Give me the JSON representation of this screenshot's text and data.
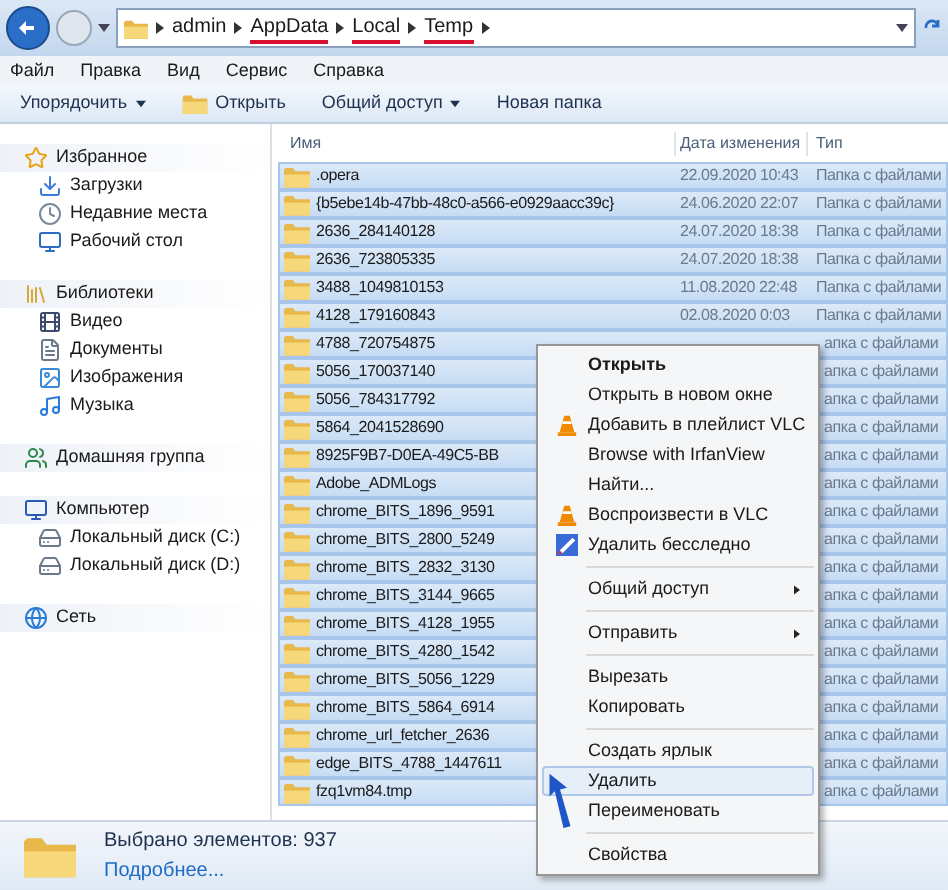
{
  "address": {
    "crumbs": [
      {
        "label": "admin",
        "underlined": false
      },
      {
        "label": "AppData",
        "underlined": true
      },
      {
        "label": "Local",
        "underlined": true
      },
      {
        "label": "Temp",
        "underlined": true
      }
    ]
  },
  "menu_bar": [
    "Файл",
    "Правка",
    "Вид",
    "Сервис",
    "Справка"
  ],
  "toolbar": [
    {
      "label": "Упорядочить",
      "dropdown": true,
      "icon": false
    },
    {
      "label": "Открыть",
      "dropdown": false,
      "icon": true
    },
    {
      "label": "Общий доступ",
      "dropdown": true,
      "icon": false
    },
    {
      "label": "Новая папка",
      "dropdown": false,
      "icon": false
    }
  ],
  "sidebar": {
    "groups": [
      {
        "label": "Избранное",
        "children": [
          {
            "label": "Загрузки"
          },
          {
            "label": "Недавние места"
          },
          {
            "label": "Рабочий стол"
          }
        ]
      },
      {
        "label": "Библиотеки",
        "children": [
          {
            "label": "Видео"
          },
          {
            "label": "Документы"
          },
          {
            "label": "Изображения"
          },
          {
            "label": "Музыка"
          }
        ]
      },
      {
        "label": "Домашняя группа"
      },
      {
        "label": "Компьютер",
        "children": [
          {
            "label": "Локальный диск (C:)"
          },
          {
            "label": "Локальный диск (D:)"
          }
        ]
      },
      {
        "label": "Сеть"
      }
    ]
  },
  "table": {
    "columns": [
      "Имя",
      "Дата изменения",
      "Тип"
    ],
    "rows": [
      {
        "name": ".opera",
        "date": "22.09.2020 10:43",
        "type": "Папка с файлами",
        "selected": true
      },
      {
        "name": "{b5ebe14b-47bb-48c0-a566-e0929aacc39c}",
        "date": "24.06.2020 22:07",
        "type": "Папка с файлами",
        "selected": true
      },
      {
        "name": "2636_284140128",
        "date": "24.07.2020 18:38",
        "type": "Папка с файлами",
        "selected": true
      },
      {
        "name": "2636_723805335",
        "date": "24.07.2020 18:38",
        "type": "Папка с файлами",
        "selected": true
      },
      {
        "name": "3488_1049810153",
        "date": "11.08.2020 22:48",
        "type": "Папка с файлами",
        "selected": true
      },
      {
        "name": "4128_179160843",
        "date": "02.08.2020 0:03",
        "type": "Папка с файлами",
        "selected": true
      },
      {
        "name": "4788_720754875",
        "type": "апка с файлами",
        "selected": true
      },
      {
        "name": "5056_170037140",
        "type": "апка с файлами",
        "selected": true
      },
      {
        "name": "5056_784317792",
        "type": "апка с файлами",
        "selected": true
      },
      {
        "name": "5864_2041528690",
        "type": "апка с файлами",
        "selected": true
      },
      {
        "name": "8925F9B7-D0EA-49C5-BB",
        "type": "апка с файлами",
        "selected": true
      },
      {
        "name": "Adobe_ADMLogs",
        "type": "апка с файлами",
        "selected": true
      },
      {
        "name": "chrome_BITS_1896_9591",
        "type": "апка с файлами",
        "selected": true
      },
      {
        "name": "chrome_BITS_2800_5249",
        "type": "апка с файлами",
        "selected": true
      },
      {
        "name": "chrome_BITS_2832_3130",
        "type": "апка с файлами",
        "selected": true
      },
      {
        "name": "chrome_BITS_3144_9665",
        "type": "апка с файлами",
        "selected": true
      },
      {
        "name": "chrome_BITS_4128_1955",
        "type": "апка с файлами",
        "selected": true
      },
      {
        "name": "chrome_BITS_4280_1542",
        "type": "апка с файлами",
        "selected": true
      },
      {
        "name": "chrome_BITS_5056_1229",
        "type": "апка с файлами",
        "selected": true
      },
      {
        "name": "chrome_BITS_5864_6914",
        "type": "апка с файлами",
        "selected": true
      },
      {
        "name": "chrome_url_fetcher_2636",
        "type": "апка с файлами",
        "selected": true
      },
      {
        "name": "edge_BITS_4788_1447611",
        "type": "апка с файлами",
        "selected": true
      },
      {
        "name": "fzq1vm84.tmp",
        "type": "апка с файлами",
        "selected": true
      }
    ]
  },
  "context_menu": [
    {
      "kind": "plain",
      "label": "Открыть",
      "bold": true,
      "submenu": false,
      "selected": false
    },
    {
      "kind": "plain",
      "label": "Открыть в новом окне",
      "bold": false,
      "submenu": false,
      "selected": false
    },
    {
      "kind": "vlc",
      "label": "Добавить в плейлист VLC",
      "bold": false,
      "submenu": false,
      "selected": false
    },
    {
      "kind": "plain",
      "label": "Browse with IrfanView",
      "bold": false,
      "submenu": false,
      "selected": false
    },
    {
      "kind": "plain",
      "label": "Найти...",
      "bold": false,
      "submenu": false,
      "selected": false
    },
    {
      "kind": "vlc",
      "label": "Воспроизвести в VLC",
      "bold": false,
      "submenu": false,
      "selected": false
    },
    {
      "kind": "eraser",
      "label": "Удалить бесследно",
      "bold": false,
      "submenu": false,
      "selected": false
    },
    {
      "kind": "separator"
    },
    {
      "kind": "plain",
      "label": "Общий доступ",
      "bold": false,
      "submenu": true,
      "selected": false
    },
    {
      "kind": "separator"
    },
    {
      "kind": "plain",
      "label": "Отправить",
      "bold": false,
      "submenu": true,
      "selected": false
    },
    {
      "kind": "separator"
    },
    {
      "kind": "plain",
      "label": "Вырезать",
      "bold": false,
      "submenu": false,
      "selected": false
    },
    {
      "kind": "plain",
      "label": "Копировать",
      "bold": false,
      "submenu": false,
      "selected": false
    },
    {
      "kind": "separator"
    },
    {
      "kind": "plain",
      "label": "Создать ярлык",
      "bold": false,
      "submenu": false,
      "selected": false
    },
    {
      "kind": "plain",
      "label": "Удалить",
      "bold": false,
      "submenu": false,
      "selected": true
    },
    {
      "kind": "plain",
      "label": "Переименовать",
      "bold": false,
      "submenu": false,
      "selected": false
    },
    {
      "kind": "separator"
    },
    {
      "kind": "plain",
      "label": "Свойства",
      "bold": false,
      "submenu": false,
      "selected": false
    }
  ],
  "status_bar": {
    "selection": "Выбрано элементов: 937",
    "link": "Подробнее..."
  }
}
